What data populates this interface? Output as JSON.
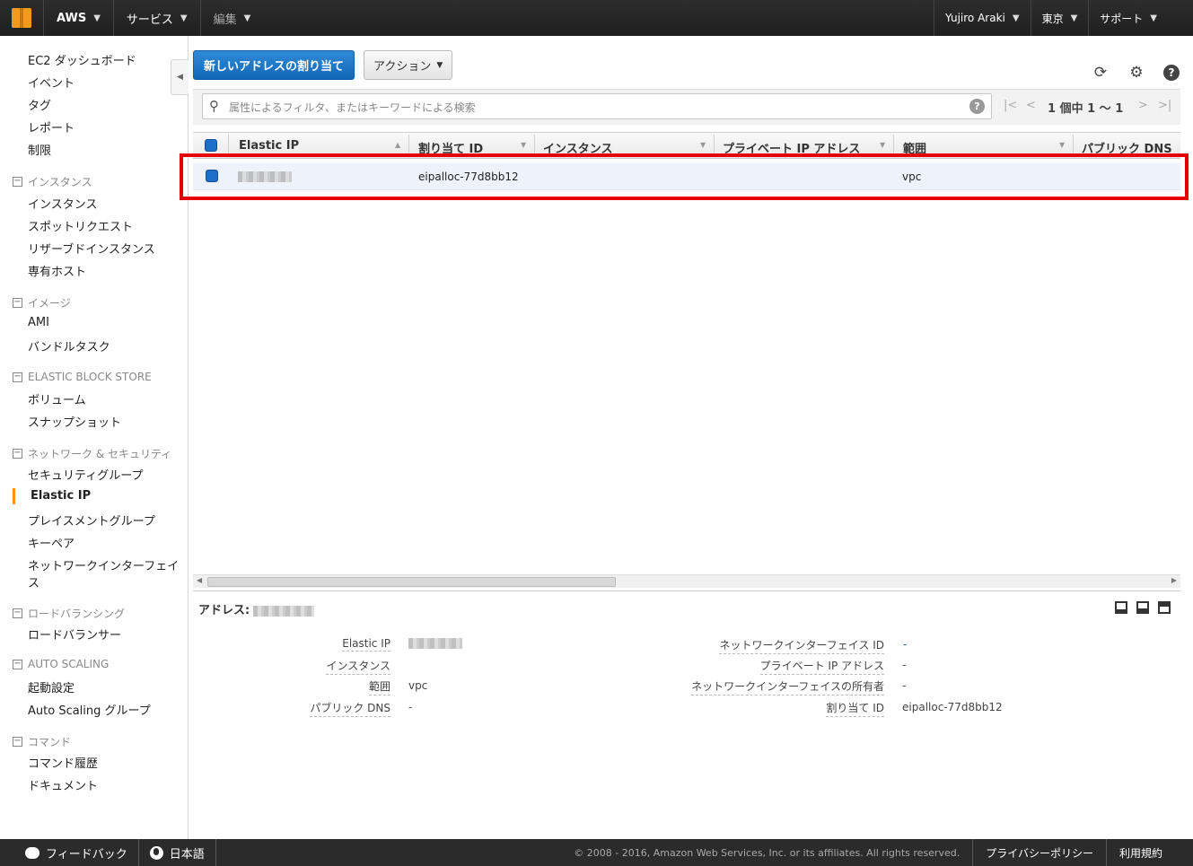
{
  "topbar": {
    "aws_label": "AWS",
    "services_label": "サービス",
    "edit_label": "編集",
    "user_label": "Yujiro Araki",
    "region_label": "東京",
    "support_label": "サポート"
  },
  "sidebar": {
    "items": {
      "ec2_dashboard": "EC2 ダッシュボード",
      "events": "イベント",
      "tags": "タグ",
      "reports": "レポート",
      "limits": "制限",
      "instances": "インスタンス",
      "spot_requests": "スポットリクエスト",
      "reserved_instances": "リザーブドインスタンス",
      "dedicated_hosts": "専有ホスト",
      "ami": "AMI",
      "bundle_tasks": "バンドルタスク",
      "volumes": "ボリューム",
      "snapshots": "スナップショット",
      "security_groups": "セキュリティグループ",
      "elastic_ip": "Elastic IP",
      "placement_groups": "プレイスメントグループ",
      "key_pairs": "キーペア",
      "network_interfaces_1": "ネットワークインターフェイ",
      "network_interfaces_2": "ス",
      "load_balancers": "ロードバランサー",
      "launch_configs": "起動設定",
      "asg": "Auto Scaling グループ",
      "command_history": "コマンド履歴",
      "documents": "ドキュメント"
    },
    "sections": {
      "instances": "インスタンス",
      "images": "イメージ",
      "ebs": "ELASTIC BLOCK STORE",
      "network_security": "ネットワーク & セキュリティ",
      "load_balancing": "ロードバランシング",
      "auto_scaling": "AUTO SCALING",
      "commands": "コマンド"
    }
  },
  "toolbar": {
    "allocate_label": "新しいアドレスの割り当て",
    "actions_label": "アクション"
  },
  "search": {
    "placeholder": "属性によるフィルタ、またはキーワードによる検索"
  },
  "pagination": {
    "text": "1 個中 1 ～ 1"
  },
  "table": {
    "columns": [
      "Elastic IP",
      "割り当て ID",
      "インスタンス",
      "プライベート IP アドレス",
      "範囲",
      "パブリック DNS"
    ],
    "rows": [
      {
        "allocation_id": "eipalloc-77d8bb12",
        "scope": "vpc"
      }
    ]
  },
  "detail": {
    "title": "アドレス:",
    "left": [
      {
        "label": "Elastic IP",
        "value": ""
      },
      {
        "label": "インスタンス",
        "value": ""
      },
      {
        "label": "範囲",
        "value": "vpc"
      },
      {
        "label": "パブリック DNS",
        "value": "-"
      }
    ],
    "right": [
      {
        "label": "ネットワークインターフェイス ID",
        "value": "-"
      },
      {
        "label": "プライベート IP アドレス",
        "value": "-"
      },
      {
        "label": "ネットワークインターフェイスの所有者",
        "value": "-"
      },
      {
        "label": "割り当て ID",
        "value": "eipalloc-77d8bb12"
      }
    ]
  },
  "footer": {
    "feedback_label": "フィードバック",
    "language_label": "日本語",
    "copyright": "© 2008 - 2016, Amazon Web Services, Inc. or its affiliates. All rights reserved.",
    "privacy_label": "プライバシーポリシー",
    "terms_label": "利用規約"
  },
  "colors": {
    "accent": "#f29a1e",
    "primary_button": "#1e6fc8",
    "highlight_box": "#e60000"
  }
}
